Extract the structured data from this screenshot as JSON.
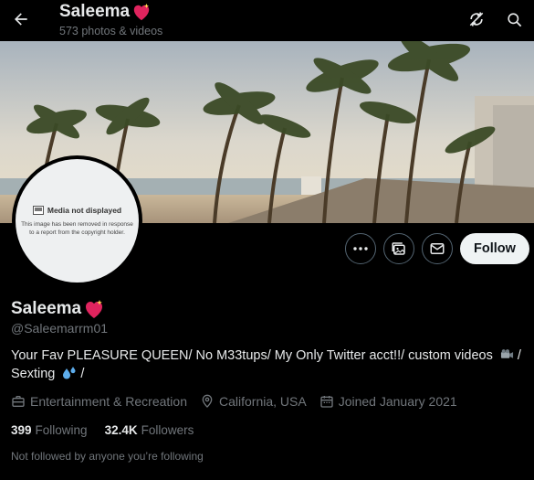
{
  "header": {
    "title": "Saleema",
    "subtitle": "573 photos & videos",
    "back_icon": "arrow-left-icon",
    "refresh_icon": "refresh-slash-icon",
    "search_icon": "search-icon"
  },
  "avatar": {
    "media_title": "Media not displayed",
    "media_text": "This image has been removed in response to a report from the copyright holder."
  },
  "actions": {
    "more_icon": "more-icon",
    "subscribe_icon": "photo-subscribe-icon",
    "message_icon": "mail-icon",
    "follow_label": "Follow"
  },
  "profile": {
    "name": "Saleema",
    "handle": "@Saleemarrm01",
    "bio_line1": "Your Fav PLEASURE QUEEN/ No M33tups/ My Only Twitter acct!!/ custom videos",
    "bio_line1_end": " /",
    "bio_line2": "Sexting",
    "bio_line2_end": " /",
    "category": "Entertainment & Recreation",
    "location": "California, USA",
    "joined": "Joined January 2021",
    "following_count": "399",
    "following_label": "Following",
    "followers_count": "32.4K",
    "followers_label": "Followers",
    "followed_note": "Not followed by anyone you’re following"
  },
  "colors": {
    "background": "#000000",
    "text_primary": "#e7e9ea",
    "text_secondary": "#71767b",
    "button_border": "#536471",
    "follow_bg": "#eff3f4",
    "heart": "#e0245e"
  }
}
